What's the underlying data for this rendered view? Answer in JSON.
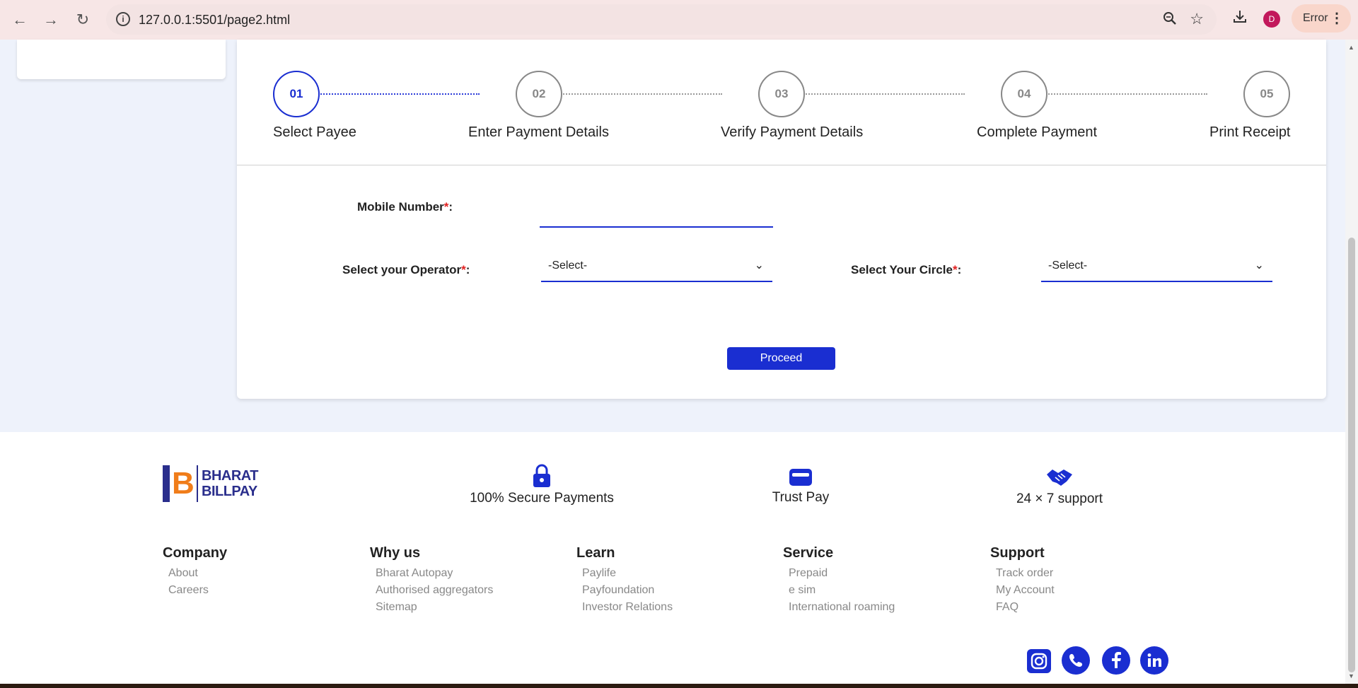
{
  "browser": {
    "url": "127.0.0.1:5501/page2.html",
    "profile_initial": "D",
    "error_label": "Error"
  },
  "stepper": {
    "steps": [
      {
        "number": "01",
        "label": "Select Payee",
        "active": true
      },
      {
        "number": "02",
        "label": "Enter Payment Details",
        "active": false
      },
      {
        "number": "03",
        "label": "Verify Payment Details",
        "active": false
      },
      {
        "number": "04",
        "label": "Complete Payment",
        "active": false
      },
      {
        "number": "05",
        "label": "Print Receipt",
        "active": false
      }
    ]
  },
  "form": {
    "mobile_label": "Mobile Number",
    "operator_label": "Select your Operator",
    "circle_label": "Select Your Circle",
    "required_mark": "*",
    "colon": ":",
    "operator_value": "-Select-",
    "circle_value": "-Select-",
    "proceed_label": "Proceed"
  },
  "footer": {
    "logo_line1": "BHARAT",
    "logo_line2": "BILLPAY",
    "logo_letter": "B",
    "features": [
      "100% Secure Payments",
      "Trust Pay",
      "24 × 7 support"
    ],
    "columns": [
      {
        "heading": "Company",
        "links": [
          "About",
          "Careers"
        ]
      },
      {
        "heading": "Why us",
        "links": [
          "Bharat Autopay",
          "Authorised aggregators",
          "Sitemap"
        ]
      },
      {
        "heading": "Learn",
        "links": [
          "Paylife",
          "Payfoundation",
          "Investor Relations"
        ]
      },
      {
        "heading": "Service",
        "links": [
          "Prepaid",
          "e sim",
          "International roaming"
        ]
      },
      {
        "heading": "Support",
        "links": [
          "Track order",
          "My Account",
          "FAQ"
        ]
      }
    ],
    "social_icons": [
      "instagram-icon",
      "whatsapp-icon",
      "facebook-icon",
      "linkedin-icon"
    ]
  },
  "colors": {
    "accent": "#1a2ed1",
    "logo_orange": "#f07d1a",
    "logo_navy": "#2a2e8c",
    "page_bg": "#eef2fb",
    "required": "#e02020"
  }
}
